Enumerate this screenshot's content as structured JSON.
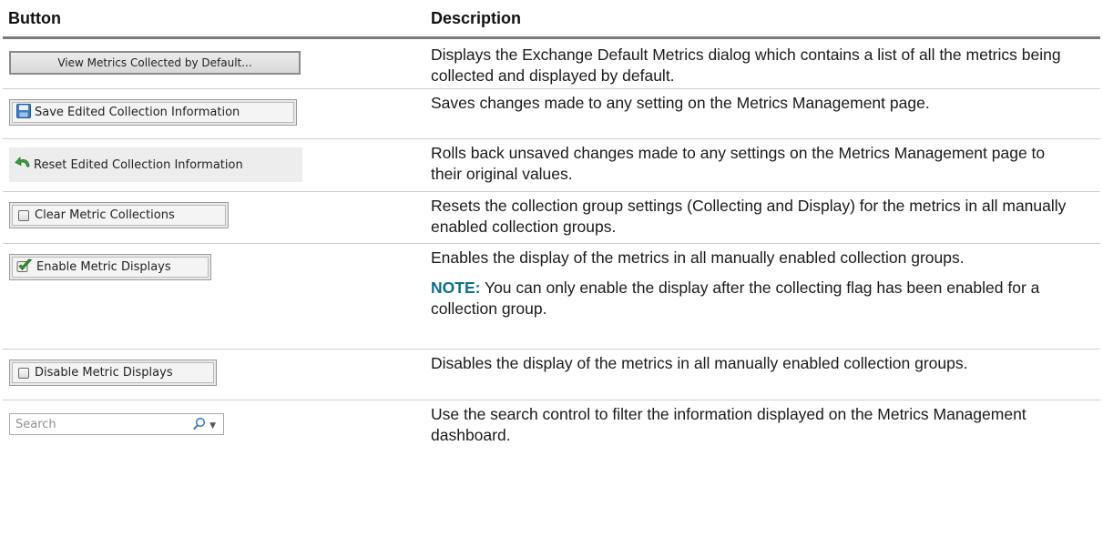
{
  "table": {
    "headers": {
      "button": "Button",
      "description": "Description"
    },
    "rows": [
      {
        "button_label": "View Metrics Collected by Default...",
        "button_icon": "",
        "description": "Displays the Exchange Default Metrics dialog which contains a list of all the metrics being collected and displayed by default."
      },
      {
        "button_label": "Save Edited Collection Information",
        "button_icon": "save-disk-icon",
        "description": "Saves changes made to any setting on the Metrics Management page."
      },
      {
        "button_label": "Reset Edited Collection Information",
        "button_icon": "reset-arrow-icon",
        "description": "Rolls back unsaved changes made to any settings on the Metrics Management page to their original values."
      },
      {
        "button_label": "Clear Metric Collections",
        "button_icon": "checkbox-icon",
        "description": "Resets the collection group settings (Collecting and Display) for the metrics in all manually enabled collection groups."
      },
      {
        "button_label": "Enable Metric Displays",
        "button_icon": "green-check-icon",
        "description": "Enables the display of the metrics in all manually enabled collection groups.",
        "note_label": "NOTE:",
        "note_text": " You can only enable the display after the collecting flag has been enabled for a collection group."
      },
      {
        "button_label": "Disable Metric Displays",
        "button_icon": "checkbox-icon",
        "description": "Disables the display of the metrics in all manually enabled collection groups."
      },
      {
        "search_placeholder": "Search",
        "button_icon": "magnifier-icon",
        "description": "Use the search control to filter the information displayed on the Metrics Management dashboard."
      }
    ]
  },
  "colors": {
    "note_label": "#0b6e8e",
    "header_rule": "#7a7a7a",
    "row_separator": "#cfcfcf"
  }
}
